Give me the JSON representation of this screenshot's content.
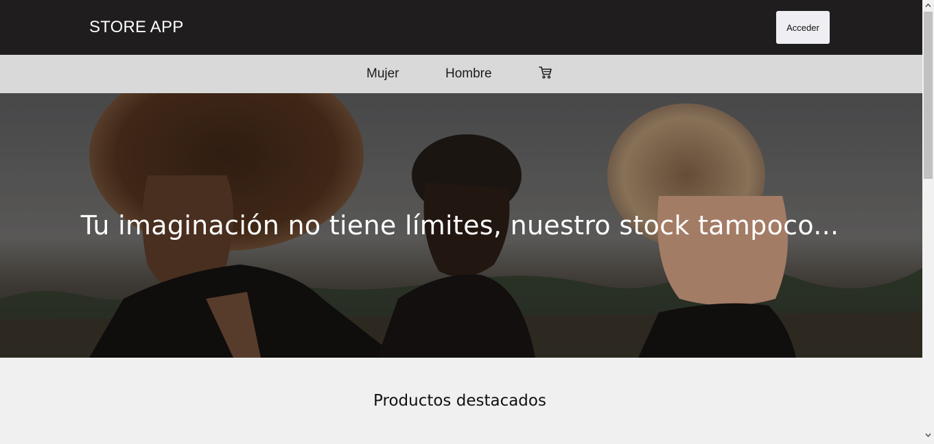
{
  "header": {
    "brand": "STORE APP",
    "login_label": "Acceder"
  },
  "nav": {
    "items": [
      {
        "label": "Mujer"
      },
      {
        "label": "Hombre"
      }
    ],
    "cart_icon": "cart-icon"
  },
  "hero": {
    "title": "Tu imaginación no tiene límites, nuestro stock tampoco..."
  },
  "featured": {
    "title": "Productos destacados"
  },
  "colors": {
    "topbar": "#1f1d1d",
    "navbar": "#d9d9d9",
    "page_bg": "#f0f0f0",
    "button_bg": "#efeef3"
  }
}
